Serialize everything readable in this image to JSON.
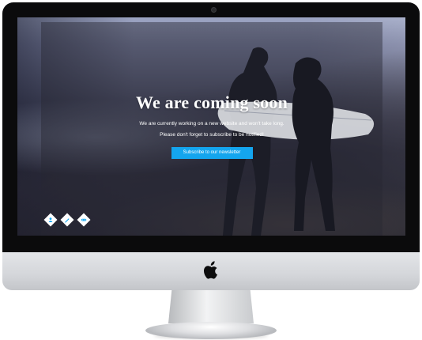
{
  "hero": {
    "title": "We are coming soon",
    "line1": "We are currently working on a new website and won't take long.",
    "line2": "Please don't forget to subscribe to be notified!",
    "button_label": "Subscribe to our newsletter"
  },
  "social": {
    "icons": [
      "user-icon",
      "pencil-icon",
      "link-icon"
    ]
  },
  "colors": {
    "button": "#14a5ee",
    "bezel": "#0b0b0c",
    "chin": "#d4d6da"
  }
}
